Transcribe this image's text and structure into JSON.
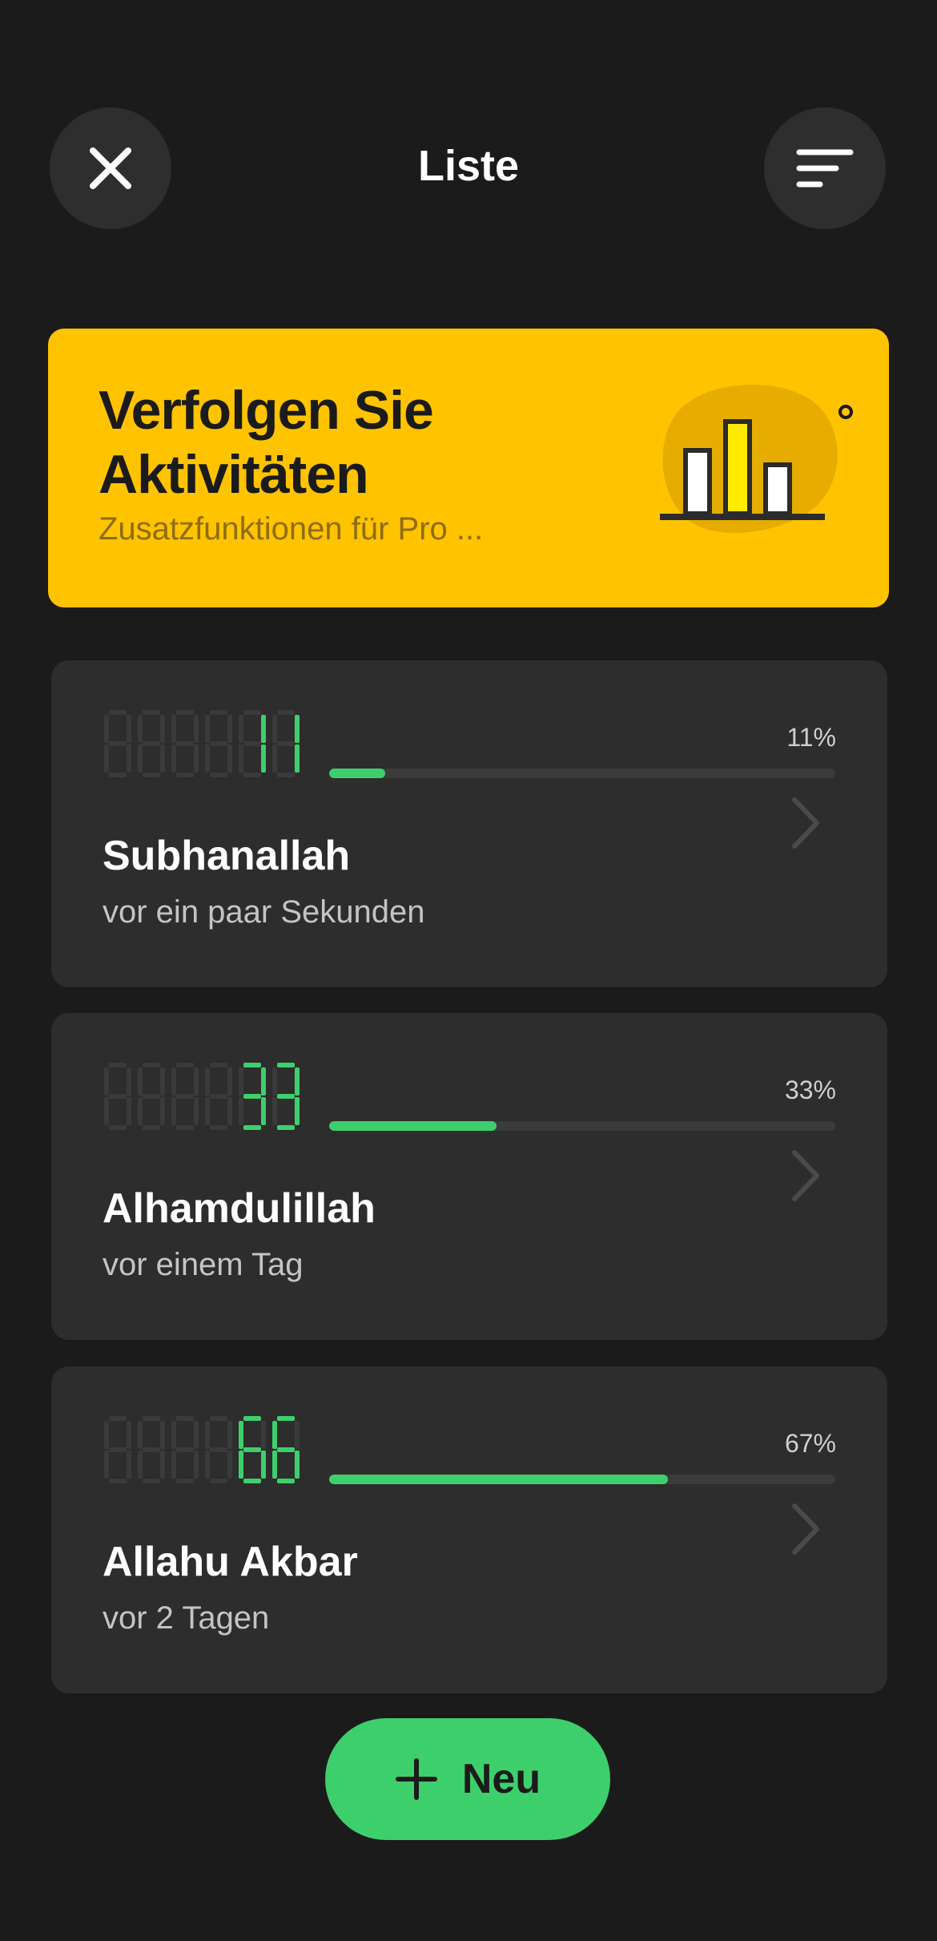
{
  "header": {
    "title": "Liste",
    "close_icon": "close-icon",
    "sort_icon": "sort-icon"
  },
  "promo": {
    "title_line1": "Verfolgen Sie",
    "title_line2": "Aktivitäten",
    "subtitle": "Zusatzfunktionen für Pro ...",
    "icon": "bar-chart-illustration",
    "background_color": "#ffc300"
  },
  "counters": [
    {
      "name": "Subhanallah",
      "count_display": "000011",
      "percent_label": "11%",
      "progress": 0.11,
      "time": "vor ein paar Sekunden"
    },
    {
      "name": "Alhamdulillah",
      "count_display": "000033",
      "percent_label": "33%",
      "progress": 0.33,
      "time": "vor einem Tag"
    },
    {
      "name": "Allahu Akbar",
      "count_display": "000066",
      "percent_label": "67%",
      "progress": 0.67,
      "time": "vor 2 Tagen"
    }
  ],
  "new_button": {
    "label": "Neu",
    "icon": "plus-icon"
  },
  "colors": {
    "background": "#1b1b1b",
    "card": "#2d2d2d",
    "accent_green": "#3ecf6d",
    "accent_yellow": "#ffc300"
  }
}
